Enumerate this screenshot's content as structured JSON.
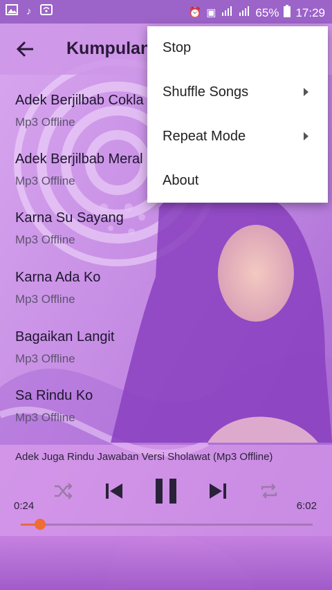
{
  "status_bar": {
    "battery": "65%",
    "time": "17:29",
    "icons_left": [
      "image-icon",
      "music-note-icon",
      "wifi-icon"
    ],
    "icons_right": [
      "alarm-icon",
      "nfc-icon",
      "signal-icon",
      "signal-icon",
      "battery-icon"
    ]
  },
  "toolbar": {
    "title": "Kumpulan"
  },
  "songs": [
    {
      "title": "Adek Berjilbab Cokla",
      "subtitle": "Mp3 Offline"
    },
    {
      "title": "Adek Berjilbab Meral",
      "subtitle": "Mp3 Offline"
    },
    {
      "title": "Karna Su Sayang",
      "subtitle": "Mp3 Offline"
    },
    {
      "title": "Karna Ada Ko",
      "subtitle": "Mp3 Offline"
    },
    {
      "title": "Bagaikan Langit",
      "subtitle": "Mp3 Offline"
    },
    {
      "title": "Sa Rindu Ko",
      "subtitle": "Mp3 Offline"
    }
  ],
  "player": {
    "now_playing": "Adek Juga Rindu Jawaban Versi Sholawat (Mp3 Offline)",
    "elapsed": "0:24",
    "duration": "6:02",
    "progress": 0.066
  },
  "menu": {
    "items": [
      {
        "label": "Stop",
        "submenu": false
      },
      {
        "label": "Shuffle Songs",
        "submenu": true
      },
      {
        "label": "Repeat Mode",
        "submenu": true
      },
      {
        "label": "About",
        "submenu": false
      }
    ]
  },
  "colors": {
    "accent": "#f06d34",
    "status_bar": "#9c63c9",
    "toolbar": "#ce96e8"
  }
}
